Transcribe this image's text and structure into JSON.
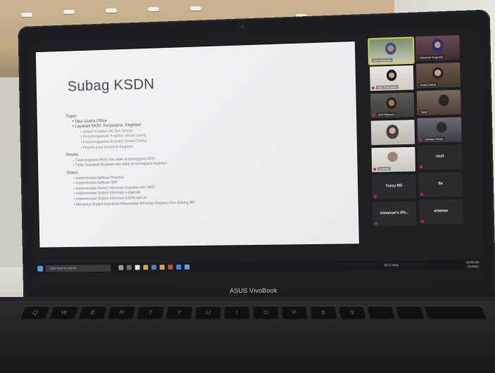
{
  "slide": {
    "title": "Subag KSDN",
    "items": [
      {
        "level": 0,
        "text": "Tugas"
      },
      {
        "level": 1,
        "text": "Tata Usaha Office"
      },
      {
        "level": 1,
        "text": "Layanan MOU, Kerjasama, Kegiatan"
      },
      {
        "level": 2,
        "text": "Jadwal Kegiatan MK Non Sidang"
      },
      {
        "level": 2,
        "text": "Penyelenggaraan Kegiatan Secara Luring"
      },
      {
        "level": 2,
        "text": "Penyelenggaraan Kegiatan Secara Daring"
      },
      {
        "level": 2,
        "text": "Peserta yang mengikuti Kegiatan"
      },
      {
        "level": 0,
        "text": "Resiko"
      },
      {
        "level": 1,
        "text": "Tidak terjadwal MOU dan tidak terselenggara MOU"
      },
      {
        "level": 1,
        "text": "Tidak Terjadwal Kegiatan dan tidak terselenggara kegiatan"
      },
      {
        "level": 0,
        "text": "Solusi"
      },
      {
        "level": 1,
        "text": "Implementasi Aplikasi Presensi"
      },
      {
        "level": 1,
        "text": "Implementasi Aplikasi SKP"
      },
      {
        "level": 1,
        "text": "Implementasi Sistem Informasi Kegiatan dan SKEI"
      },
      {
        "level": 1,
        "text": "Implementasi Sistem Informasi e-Agenda"
      },
      {
        "level": 1,
        "text": "Implementasi Sistem Informasi KSDN mkri.id"
      },
      {
        "level": 1,
        "text": "Mengukur tingkat kepuasan Masyarakat terhadap Kegiatan Non Sidang MK"
      }
    ]
  },
  "participants": {
    "t0": "Ardi Setiawan",
    "t1": "Windhari Nugraha",
    "t2": "SDL Putri Amin",
    "t3": "Indah Diana",
    "t4": "Sufi Pilipsoro",
    "t5": "Tanti",
    "t6": "",
    "t7": "Dilfaisa Dinah",
    "t8": "Damiati",
    "t9": "mutt",
    "t10": "Yossy MS",
    "t11": "Ifa",
    "t12": "Inmanuel's iPh...",
    "t13": "ariaman"
  },
  "taskbar": {
    "search_placeholder": "Type here to search",
    "weather": "31°C Hazy",
    "time": "10:00 AM",
    "date": "7/1/2021"
  },
  "laptop": {
    "brand": "ASUS VivoBook"
  },
  "keyboard": {
    "keys": [
      "Q",
      "W",
      "E",
      "R",
      "T",
      "Y",
      "U",
      "I",
      "O",
      "P",
      "8",
      "9"
    ]
  },
  "colors": {
    "active_speaker": "#c7c94a",
    "windows_blue": "#4aa3e8",
    "mic_muted": "#c62a2a"
  }
}
